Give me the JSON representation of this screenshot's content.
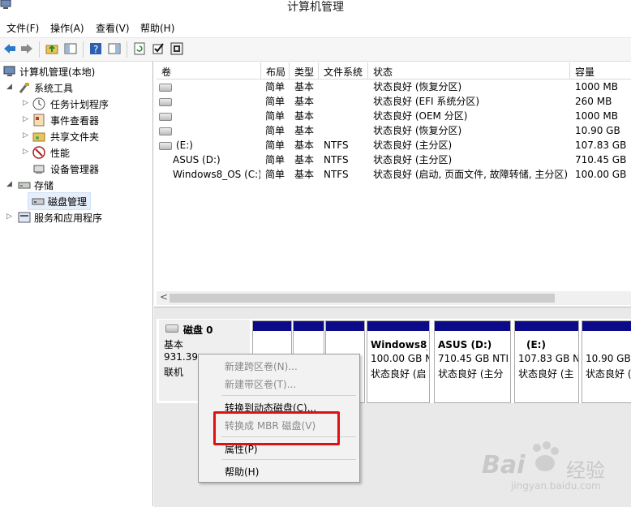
{
  "window": {
    "title": "计算机管理"
  },
  "menu": [
    "文件(F)",
    "操作(A)",
    "查看(V)",
    "帮助(H)"
  ],
  "tree": {
    "root": "计算机管理(本地)",
    "system_tools": "系统工具",
    "task_scheduler": "任务计划程序",
    "event_viewer": "事件查看器",
    "shared_folders": "共享文件夹",
    "performance": "性能",
    "device_manager": "设备管理器",
    "storage": "存储",
    "disk_management": "磁盘管理",
    "services_apps": "服务和应用程序"
  },
  "table": {
    "headers": [
      "卷",
      "布局",
      "类型",
      "文件系统",
      "状态",
      "容量"
    ],
    "rows": [
      [
        "",
        "简单",
        "基本",
        "",
        "状态良好 (恢复分区)",
        "1000 MB"
      ],
      [
        "",
        "简单",
        "基本",
        "",
        "状态良好 (EFI 系统分区)",
        "260 MB"
      ],
      [
        "",
        "简单",
        "基本",
        "",
        "状态良好 (OEM 分区)",
        "1000 MB"
      ],
      [
        "",
        "简单",
        "基本",
        "",
        "状态良好 (恢复分区)",
        "10.90 GB"
      ],
      [
        "(E:)",
        "简单",
        "基本",
        "NTFS",
        "状态良好 (主分区)",
        "107.83 GB"
      ],
      [
        "ASUS (D:)",
        "简单",
        "基本",
        "NTFS",
        "状态良好 (主分区)",
        "710.45 GB"
      ],
      [
        "Windows8_OS (C:)",
        "简单",
        "基本",
        "NTFS",
        "状态良好 (启动, 页面文件, 故障转储, 主分区)",
        "100.00 GB"
      ]
    ]
  },
  "disk": {
    "name": "磁盘 0",
    "type": "基本",
    "size": "931.39",
    "status": "联机",
    "partitions": [
      {
        "name": "Windows8_",
        "size": "100.00 GB N",
        "status": "状态良好 (启"
      },
      {
        "name": "ASUS  (D:)",
        "size": "710.45 GB NTI",
        "status": "状态良好 (主分"
      },
      {
        "name": "(E:)",
        "size": "107.83 GB N",
        "status": "状态良好 (主"
      },
      {
        "name": "",
        "size": "10.90 GB",
        "status": "状态良好 ("
      }
    ]
  },
  "context_menu": {
    "new_spanned": "新建跨区卷(N)...",
    "new_striped": "新建带区卷(T)...",
    "to_dynamic": "转换到动态磁盘(C)...",
    "to_mbr": "转换成 MBR 磁盘(V)",
    "properties": "属性(P)",
    "help": "帮助(H)"
  },
  "watermark": {
    "brand": "Bai",
    "brand2": "经验",
    "url": "jingyan.baidu.com"
  },
  "colors": {
    "partition_header": "#0b0b8a",
    "highlight": "#e01010",
    "selected": "#e5eef9"
  }
}
